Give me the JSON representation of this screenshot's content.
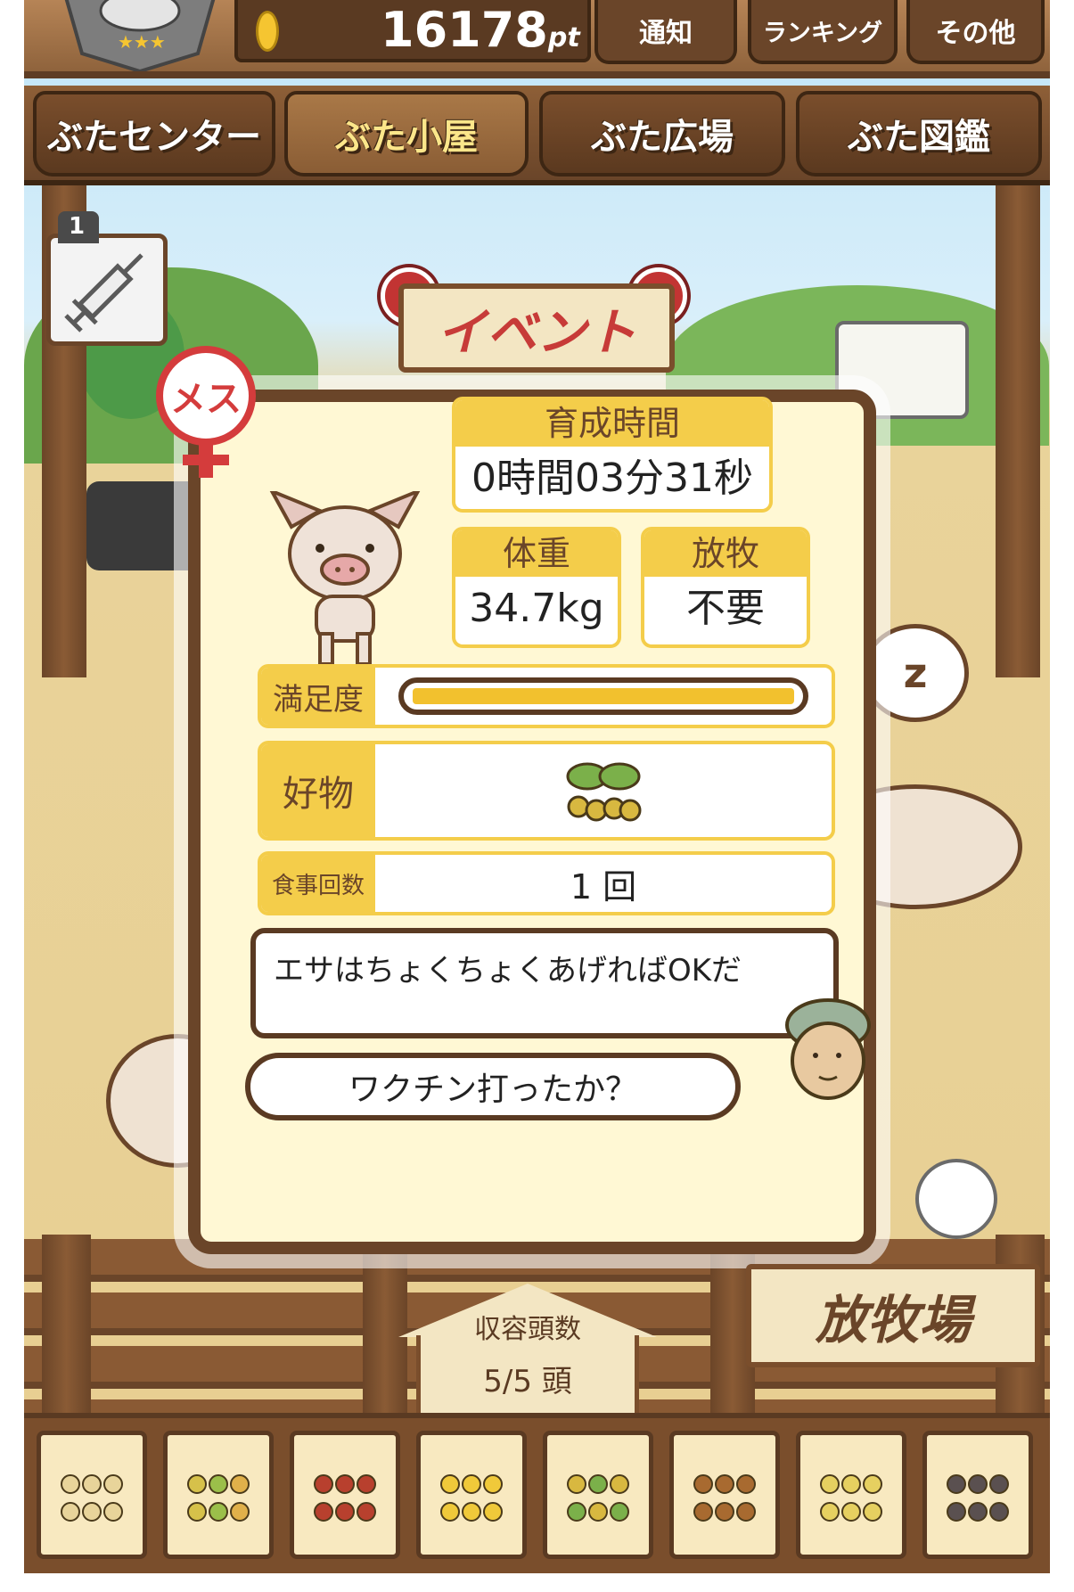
{
  "header": {
    "points_value": "16178",
    "points_unit": "pt",
    "buttons": [
      {
        "label": "通知"
      },
      {
        "label": "ランキング"
      },
      {
        "label": "その他"
      }
    ]
  },
  "nav": {
    "tabs": [
      {
        "label": "ぶたセンター",
        "active": false
      },
      {
        "label": "ぶた小屋",
        "active": true
      },
      {
        "label": "ぶた広場",
        "active": false
      },
      {
        "label": "ぶた図鑑",
        "active": false
      }
    ]
  },
  "vaccine": {
    "count": "1",
    "icon": "syringe-icon"
  },
  "event_sign": {
    "label": "イベント"
  },
  "pig_card": {
    "gender_label": "メス",
    "rating": {
      "filled": 3,
      "total": 5
    },
    "growth_time": {
      "label": "育成時間",
      "value": "0時間03分31秒"
    },
    "weight": {
      "label": "体重",
      "value": "34.7kg"
    },
    "grazing": {
      "label": "放牧",
      "value": "不要"
    },
    "satisfaction": {
      "label": "満足度",
      "level_fraction": 1.0
    },
    "favorite": {
      "label": "好物",
      "icon": "soybean-sprout-icon"
    },
    "meals": {
      "label": "食事回数",
      "value": "1 回"
    },
    "hint": "エサはちょくちょくあげればOKだ",
    "question": "ワクチン打ったか？"
  },
  "capacity": {
    "label": "収容頭数",
    "value": "5/5 頭"
  },
  "pasture_sign": {
    "label": "放牧場"
  },
  "food_items": [
    {
      "icon": "soybeans-icon"
    },
    {
      "icon": "mixed-beans-icon"
    },
    {
      "icon": "sweet-potato-icon"
    },
    {
      "icon": "corn-icon"
    },
    {
      "icon": "soybean-sprout-icon"
    },
    {
      "icon": "acorn-icon"
    },
    {
      "icon": "bean-plate-icon"
    },
    {
      "icon": "dark-bean-plate-icon"
    }
  ],
  "colors": {
    "wood": "#6a4529",
    "accent_yellow": "#f4cd4a",
    "card_bg": "#fff8d4",
    "female_red": "#d43c3c"
  }
}
